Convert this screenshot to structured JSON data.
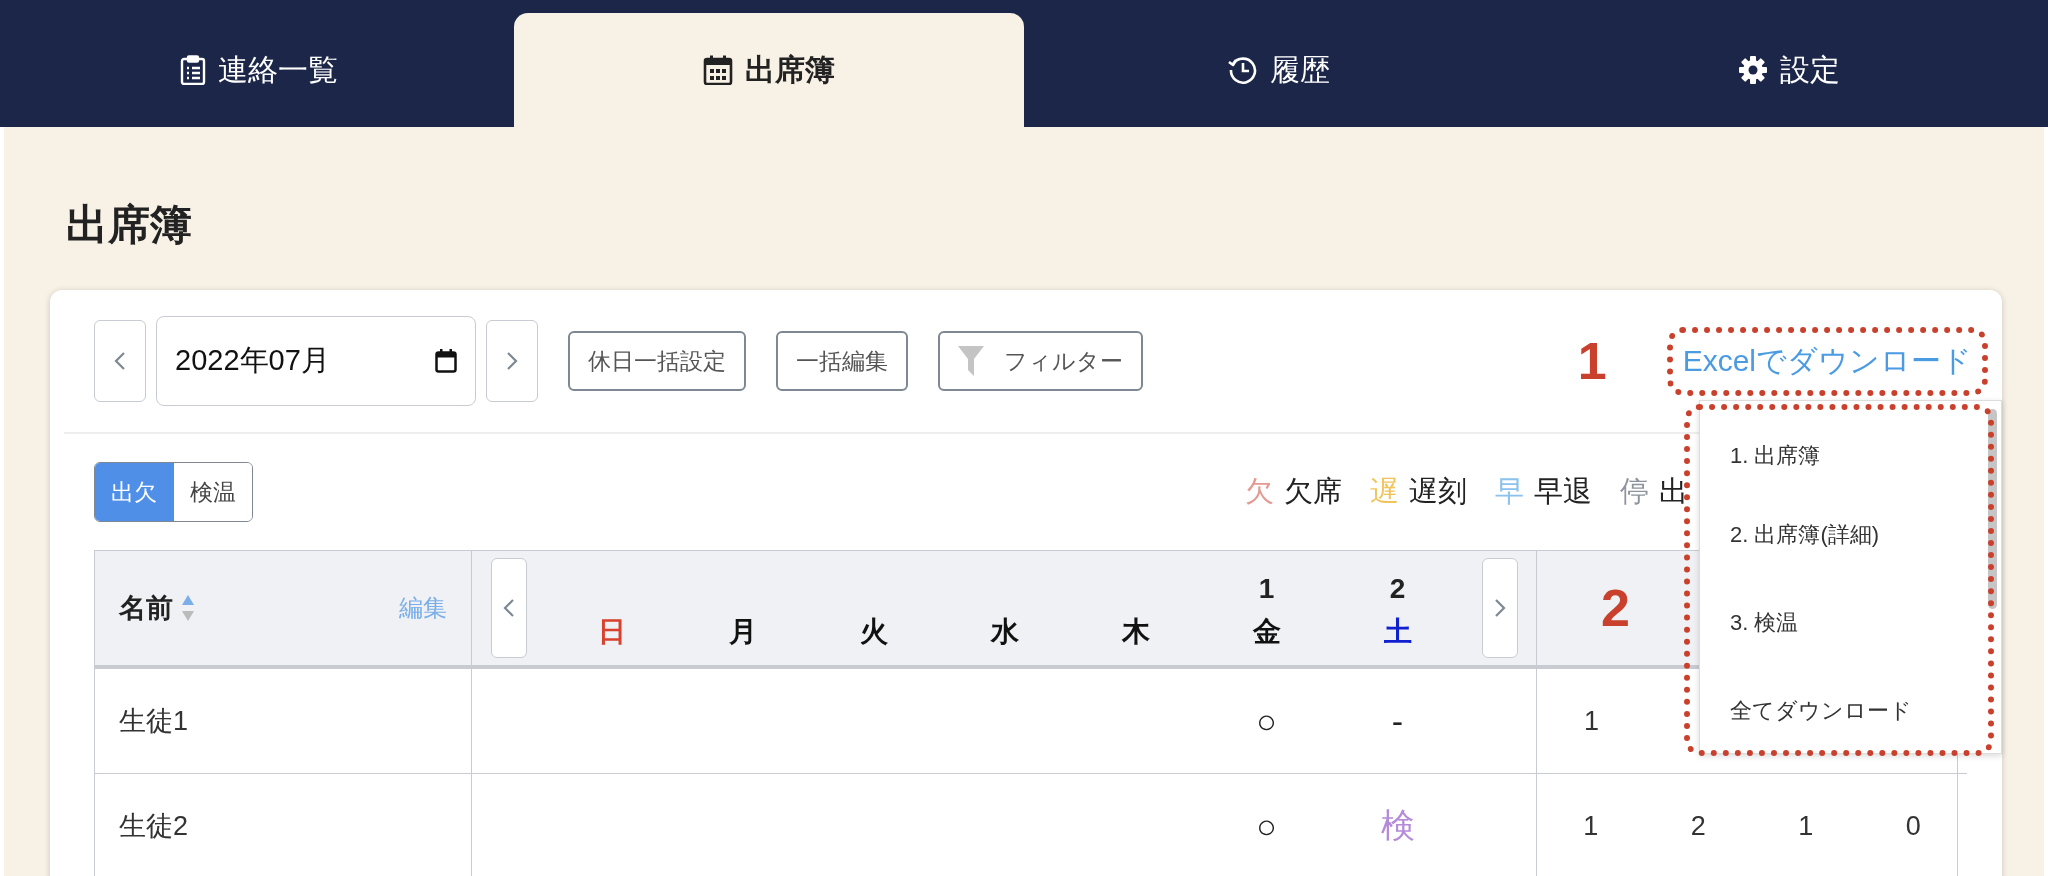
{
  "tabs": [
    {
      "label": "連絡一覧",
      "selected": false
    },
    {
      "label": "出席簿",
      "selected": true
    },
    {
      "label": "履歴",
      "selected": false
    },
    {
      "label": "設定",
      "selected": false
    }
  ],
  "page_title": "出席簿",
  "toolbar": {
    "month_value": "2022年07月",
    "buttons": [
      {
        "label": "休日一括設定",
        "kind": "plain"
      },
      {
        "label": "一括編集",
        "kind": "plain"
      },
      {
        "label": "フィルター",
        "kind": "filter"
      }
    ],
    "annotation": "1",
    "download_link": "Excelでダウンロード"
  },
  "download_menu": {
    "items": [
      "1. 出席簿",
      "2. 出席簿(詳細)",
      "3. 検温",
      "全てダウンロード"
    ]
  },
  "view_toggle": [
    {
      "label": "出欠",
      "selected": true
    },
    {
      "label": "検温",
      "selected": false
    }
  ],
  "legend": [
    {
      "symbol": "欠",
      "label": "欠席",
      "color": "#e39a92"
    },
    {
      "symbol": "遅",
      "label": "遅刻",
      "color": "#f0c45a"
    },
    {
      "symbol": "早",
      "label": "早退",
      "color": "#8cc2ee"
    },
    {
      "symbol": "停",
      "label": "出",
      "color": "#8c949e"
    }
  ],
  "table": {
    "name_header": "名前",
    "edit_link": "編集",
    "summary_annotation": "2",
    "days": [
      {
        "weekday": "日",
        "kind": "sunday"
      },
      {
        "weekday": "月",
        "kind": "weekday"
      },
      {
        "weekday": "火",
        "kind": "weekday"
      },
      {
        "weekday": "水",
        "kind": "weekday"
      },
      {
        "weekday": "木",
        "kind": "weekday"
      },
      {
        "date": "1",
        "weekday": "金",
        "kind": "weekday"
      },
      {
        "date": "2",
        "weekday": "土",
        "kind": "saturday"
      }
    ],
    "rows": [
      {
        "name": "生徒1",
        "cells": [
          {
            "kind": "empty"
          },
          {
            "kind": "empty"
          },
          {
            "kind": "empty"
          },
          {
            "kind": "empty"
          },
          {
            "kind": "empty"
          },
          {
            "kind": "attendance",
            "text": "○"
          },
          {
            "kind": "attendance",
            "text": "-"
          }
        ],
        "summary": [
          "1"
        ]
      },
      {
        "name": "生徒2",
        "cells": [
          {
            "kind": "empty"
          },
          {
            "kind": "empty"
          },
          {
            "kind": "empty"
          },
          {
            "kind": "empty"
          },
          {
            "kind": "empty"
          },
          {
            "kind": "attendance",
            "text": "○"
          },
          {
            "kind": "temperature",
            "text": "検"
          }
        ],
        "summary": [
          "1",
          "2",
          "1",
          "0"
        ]
      }
    ]
  }
}
